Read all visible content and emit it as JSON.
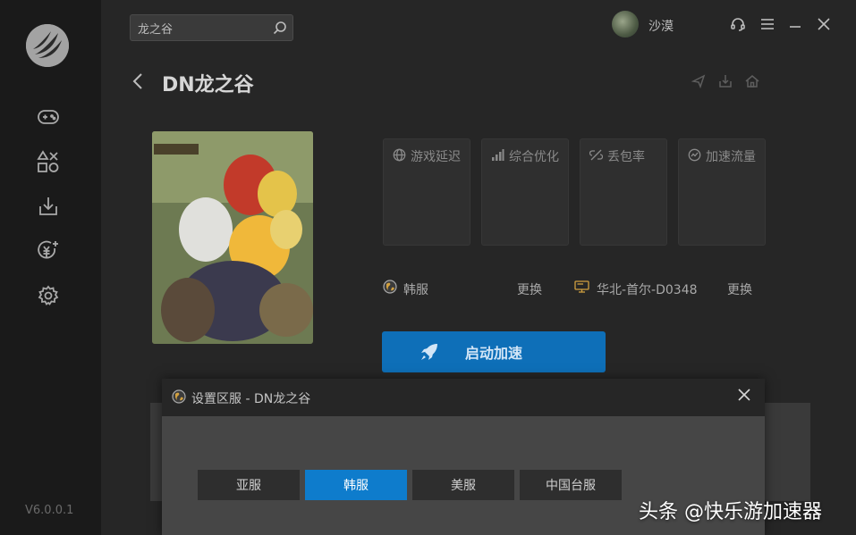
{
  "app": {
    "version": "V6.0.0.1",
    "accent": "#0e6fb8"
  },
  "search": {
    "value": "龙之谷"
  },
  "user": {
    "name": "沙漠"
  },
  "game": {
    "title": "DN龙之谷"
  },
  "stats": [
    {
      "label": "游戏延迟",
      "icon": "globe-icon"
    },
    {
      "label": "综合优化",
      "icon": "signal-bars-icon"
    },
    {
      "label": "丢包率",
      "icon": "broken-link-icon"
    },
    {
      "label": "加速流量",
      "icon": "gauge-icon"
    }
  ],
  "region": {
    "name": "韩服",
    "change_label": "更换"
  },
  "node": {
    "name": "华北-首尔-D0348",
    "change_label": "更换"
  },
  "start_button": {
    "label": "启动加速"
  },
  "dialog": {
    "title": "设置区服  - DN龙之谷",
    "options": [
      {
        "label": "亚服",
        "selected": false
      },
      {
        "label": "韩服",
        "selected": true
      },
      {
        "label": "美服",
        "selected": false
      },
      {
        "label": "中国台服",
        "selected": false
      }
    ]
  },
  "watermark": {
    "text": "头条 @快乐游加速器"
  }
}
